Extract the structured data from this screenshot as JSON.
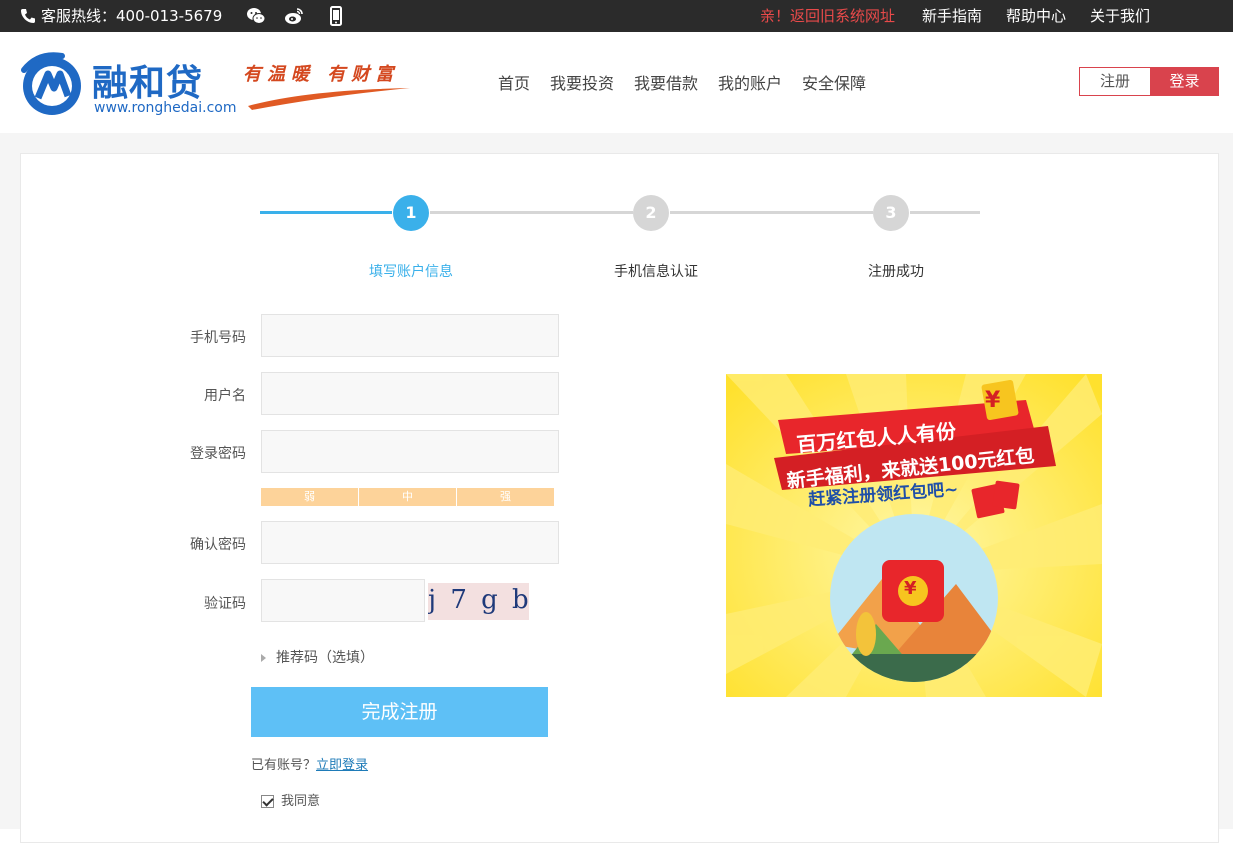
{
  "topbar": {
    "hotline": "客服热线：400-013-5679",
    "return_old": "亲！返回旧系统网址",
    "links": [
      "新手指南",
      "帮助中心",
      "关于我们"
    ]
  },
  "header": {
    "logo_text": "融和贷",
    "logo_url": "www.ronghedai.com",
    "slogan": "有温暖 有财富",
    "nav": [
      "首页",
      "我要投资",
      "我要借款",
      "我的账户",
      "安全保障"
    ],
    "register": "注册",
    "login": "登录"
  },
  "steps": [
    {
      "num": "1",
      "label": "填写账户信息",
      "active": true
    },
    {
      "num": "2",
      "label": "手机信息认证",
      "active": false
    },
    {
      "num": "3",
      "label": "注册成功",
      "active": false
    }
  ],
  "form": {
    "phone_label": "手机号码",
    "username_label": "用户名",
    "password_label": "登录密码",
    "strength": [
      "弱",
      "中",
      "强"
    ],
    "confirm_label": "确认密码",
    "captcha_label": "验证码",
    "captcha_text": "j 7 g b",
    "referral": "推荐码（选填）",
    "submit": "完成注册",
    "have_account": "已有账号？",
    "login_now": "立即登录",
    "agree": "我同意"
  },
  "promo": {
    "line1": "百万红包人人有份",
    "line2": "新手福利，来就送100元红包",
    "line3": "赶紧注册领红包吧~",
    "yen": "¥"
  },
  "colors": {
    "accent_blue": "#3ab0ea",
    "brand_red": "#d9434d",
    "step_inactive": "#d6d6d6"
  }
}
